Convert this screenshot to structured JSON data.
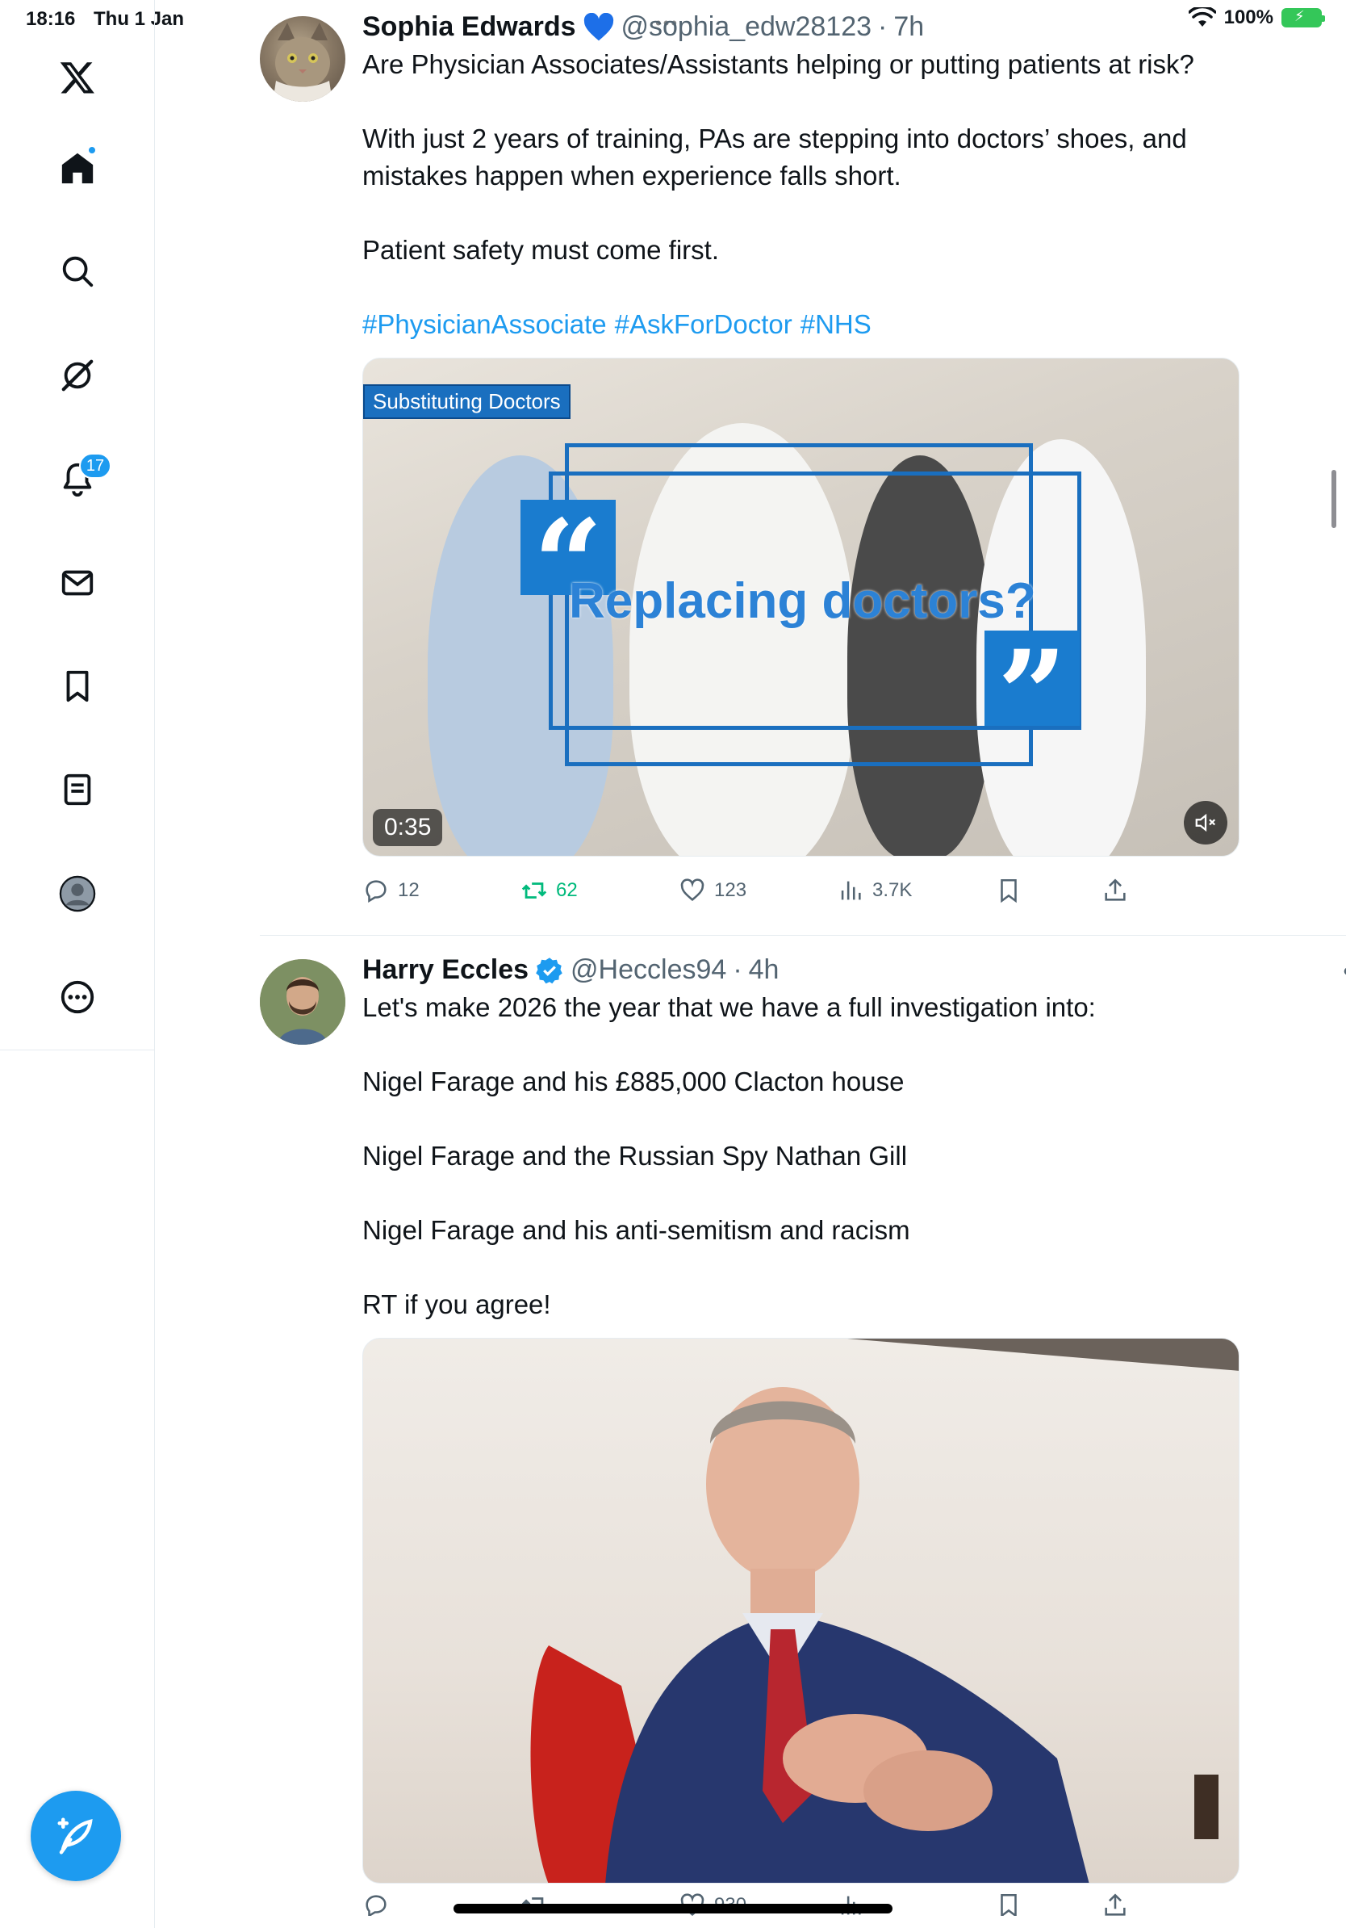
{
  "status_bar": {
    "time": "18:16",
    "date": "Thu 1 Jan",
    "dots": "•••",
    "battery": "100%"
  },
  "sidebar": {
    "items": [
      {
        "name": "x-logo",
        "icon": "x-logo-icon"
      },
      {
        "name": "home",
        "icon": "home-icon",
        "has_dot": true
      },
      {
        "name": "search",
        "icon": "search-icon"
      },
      {
        "name": "grok",
        "icon": "grok-icon"
      },
      {
        "name": "notifications",
        "icon": "bell-icon",
        "badge": "17"
      },
      {
        "name": "messages",
        "icon": "envelope-icon"
      },
      {
        "name": "bookmarks",
        "icon": "bookmark-icon"
      },
      {
        "name": "lists",
        "icon": "list-icon"
      },
      {
        "name": "profile",
        "icon": "profile-icon"
      },
      {
        "name": "more",
        "icon": "more-circle-icon"
      }
    ],
    "compose": {
      "icon": "compose-feather-icon"
    }
  },
  "tweets": [
    {
      "name": "Sophia Edwards",
      "handle": "@sophia_edw28123",
      "sep": "·",
      "time": "7h",
      "paragraphs": [
        "Are Physician Associates/Assistants helping or putting patients at risk?",
        "With just 2 years of training, PAs are stepping into doctors’ shoes, and mistakes happen when experience falls short.",
        "Patient safety must come first."
      ],
      "hashtags": [
        "#PhysicianAssociate",
        "#AskForDoctor",
        "#NHS"
      ],
      "media": {
        "type": "video",
        "label": "Substituting Doctors",
        "overlay_text": "Replacing doctors?",
        "duration": "0:35"
      },
      "actions": {
        "replies": "12",
        "retweets": "62",
        "likes": "123",
        "views": "3.7K"
      }
    },
    {
      "name": "Harry Eccles",
      "handle": "@Heccles94",
      "sep": "·",
      "time": "4h",
      "more": "•••",
      "paragraphs": [
        "Let's make 2026 the year that we have a full investigation into:",
        "Nigel Farage and his £885,000 Clacton house",
        "Nigel Farage and the Russian Spy Nathan Gill",
        "Nigel Farage and his anti-semitism and racism",
        "RT if you agree!"
      ],
      "media": {
        "type": "photo"
      },
      "actions": {
        "likes": "930"
      }
    }
  ],
  "colors": {
    "accent": "#1d9bf0",
    "retweet": "#00ba7c",
    "secondary_text": "#536471"
  }
}
